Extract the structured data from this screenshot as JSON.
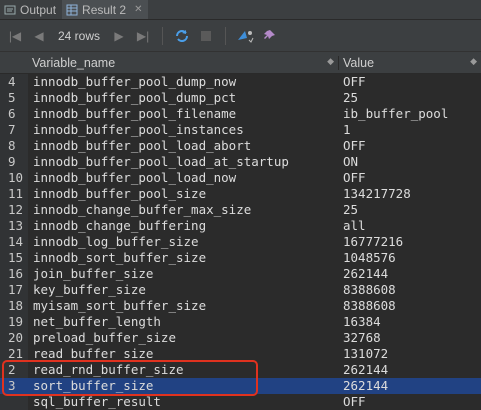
{
  "tabs": [
    {
      "label": "Output",
      "active": false
    },
    {
      "label": "Result 2",
      "active": true
    }
  ],
  "toolbar": {
    "row_count": "24 rows"
  },
  "columns": [
    "Variable_name",
    "Value"
  ],
  "rows": [
    {
      "n": "4",
      "name": "innodb_buffer_pool_dump_now",
      "value": "OFF"
    },
    {
      "n": "5",
      "name": "innodb_buffer_pool_dump_pct",
      "value": "25"
    },
    {
      "n": "6",
      "name": "innodb_buffer_pool_filename",
      "value": "ib_buffer_pool"
    },
    {
      "n": "7",
      "name": "innodb_buffer_pool_instances",
      "value": "1"
    },
    {
      "n": "8",
      "name": "innodb_buffer_pool_load_abort",
      "value": "OFF"
    },
    {
      "n": "9",
      "name": "innodb_buffer_pool_load_at_startup",
      "value": "ON"
    },
    {
      "n": "10",
      "name": "innodb_buffer_pool_load_now",
      "value": "OFF"
    },
    {
      "n": "11",
      "name": "innodb_buffer_pool_size",
      "value": "134217728"
    },
    {
      "n": "12",
      "name": "innodb_change_buffer_max_size",
      "value": "25"
    },
    {
      "n": "13",
      "name": "innodb_change_buffering",
      "value": "all"
    },
    {
      "n": "14",
      "name": "innodb_log_buffer_size",
      "value": "16777216"
    },
    {
      "n": "15",
      "name": "innodb_sort_buffer_size",
      "value": "1048576"
    },
    {
      "n": "16",
      "name": "join_buffer_size",
      "value": "262144"
    },
    {
      "n": "17",
      "name": "key_buffer_size",
      "value": "8388608"
    },
    {
      "n": "18",
      "name": "myisam_sort_buffer_size",
      "value": "8388608"
    },
    {
      "n": "19",
      "name": "net_buffer_length",
      "value": "16384"
    },
    {
      "n": "20",
      "name": "preload_buffer_size",
      "value": "32768"
    },
    {
      "n": "21",
      "name": "read_buffer_size",
      "value": "131072"
    },
    {
      "n": "2",
      "name": "read_rnd_buffer_size",
      "value": "262144"
    },
    {
      "n": "3",
      "name": "sort_buffer_size",
      "value": "262144",
      "selected": true
    },
    {
      "n": "",
      "name": "sql_buffer_result",
      "value": "OFF"
    }
  ],
  "colors": {
    "selection": "#214283",
    "highlight_box": "#e0321f"
  }
}
